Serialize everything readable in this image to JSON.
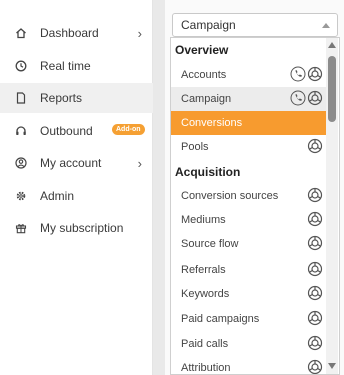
{
  "sidebar": {
    "items": [
      {
        "label": "Dashboard",
        "icon": "home-icon",
        "has_submenu": true
      },
      {
        "label": "Real time",
        "icon": "clock-icon"
      },
      {
        "label": "Reports",
        "icon": "document-icon",
        "active": true
      },
      {
        "label": "Outbound",
        "icon": "headset-icon",
        "badge": "Add-on"
      },
      {
        "label": "My account",
        "icon": "user-circle-icon",
        "has_submenu": true
      },
      {
        "label": "Admin",
        "icon": "gear-icon"
      },
      {
        "label": "My subscription",
        "icon": "gift-icon"
      }
    ],
    "chevron": "›"
  },
  "dropdown": {
    "value": "Campaign",
    "groups": [
      {
        "label": "Overview",
        "options": [
          {
            "label": "Accounts",
            "icons": [
              "phone-icon",
              "web-icon"
            ]
          },
          {
            "label": "Campaign",
            "icons": [
              "phone-icon",
              "web-icon"
            ],
            "selected": true
          },
          {
            "label": "Conversions",
            "icons": [],
            "highlighted": true
          },
          {
            "label": "Pools",
            "icons": [
              "web-icon"
            ]
          }
        ]
      },
      {
        "label": "Acquisition",
        "options": [
          {
            "label": "Conversion sources",
            "icons": [
              "web-icon"
            ]
          },
          {
            "label": "Mediums",
            "icons": [
              "web-icon"
            ]
          },
          {
            "label": "Source flow",
            "icons": [
              "web-icon"
            ]
          },
          {
            "label": "Referrals",
            "icons": [
              "web-icon"
            ]
          },
          {
            "label": "Keywords",
            "icons": [
              "web-icon"
            ]
          },
          {
            "label": "Paid campaigns",
            "icons": [
              "web-icon"
            ]
          },
          {
            "label": "Paid calls",
            "icons": [
              "web-icon"
            ]
          },
          {
            "label": "Attribution",
            "icons": [
              "web-icon"
            ]
          }
        ]
      }
    ]
  },
  "colors": {
    "accent": "#f79b2f",
    "badge": "#f5a033"
  }
}
